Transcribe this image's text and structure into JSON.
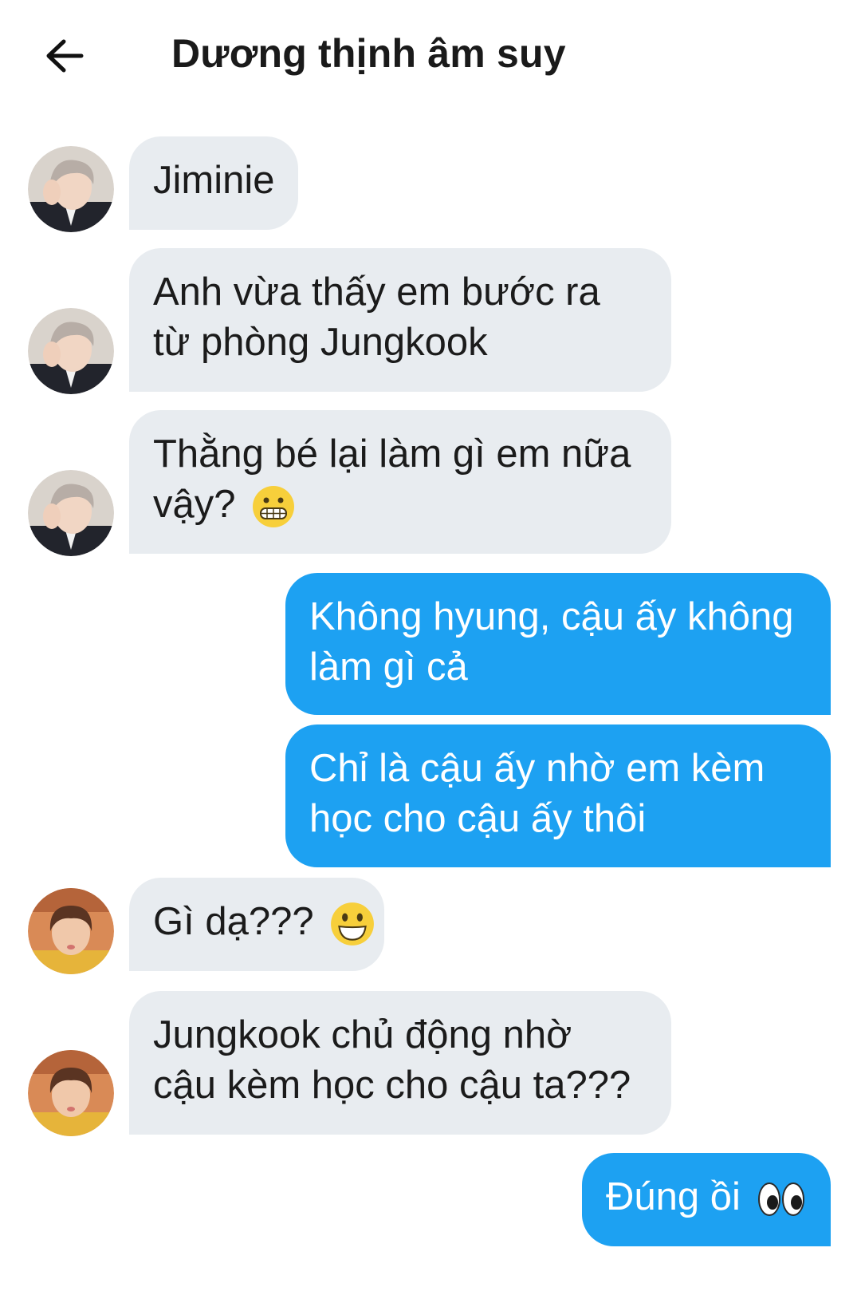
{
  "header": {
    "title": "Dương thịnh âm suy"
  },
  "messages": [
    {
      "sender": "contact_1",
      "direction": "incoming",
      "line1": "Jiminie"
    },
    {
      "sender": "contact_1",
      "direction": "incoming",
      "line1": "Anh vừa thấy em bước ra",
      "line2": "từ phòng Jungkook"
    },
    {
      "sender": "contact_1",
      "direction": "incoming",
      "line1": "Thằng bé lại làm gì em nữa",
      "line2": "vậy?",
      "emoji": "grimacing-face-emoji"
    },
    {
      "sender": "self",
      "direction": "outgoing",
      "line1": "Không hyung, cậu ấy không",
      "line2": "làm gì cả"
    },
    {
      "sender": "self",
      "direction": "outgoing",
      "line1": "Chỉ là cậu ấy nhờ em kèm",
      "line2": "học cho cậu ấy thôi"
    },
    {
      "sender": "contact_2",
      "direction": "incoming",
      "line1": "Gì dạ???",
      "emoji": "grinning-face-emoji"
    },
    {
      "sender": "contact_2",
      "direction": "incoming",
      "line1": "Jungkook chủ động nhờ",
      "line2": "cậu kèm học cho cậu ta???"
    },
    {
      "sender": "self",
      "direction": "outgoing",
      "line1": "Đúng ồi",
      "emoji": "eyes-emoji"
    }
  ],
  "colors": {
    "incoming_bubble": "#e8ecf0",
    "outgoing_bubble": "#1da1f2",
    "text": "#1b1b1b"
  },
  "icons": {
    "back": "arrow-left-icon",
    "avatar_1": "avatar-photo-gray-hair",
    "avatar_2": "avatar-photo-brown-hair"
  }
}
